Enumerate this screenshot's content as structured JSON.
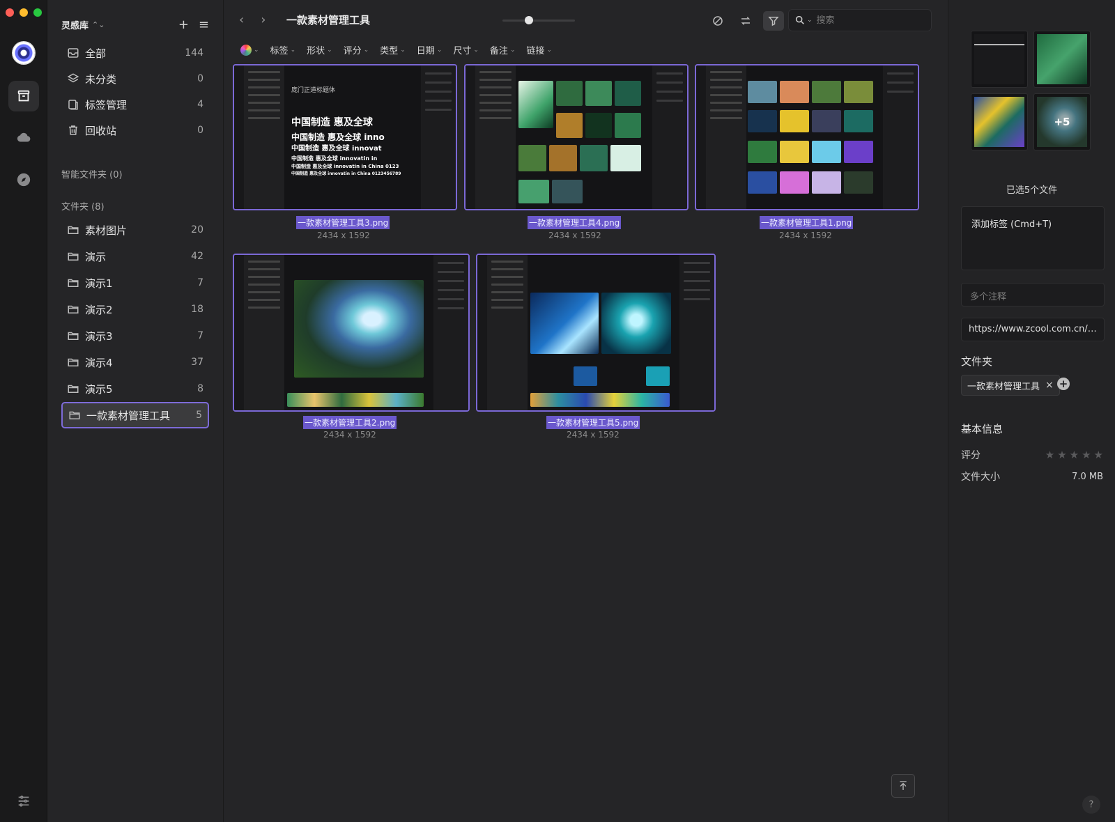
{
  "sidebar": {
    "library_title": "灵感库",
    "nav": [
      {
        "label": "全部",
        "count": "144"
      },
      {
        "label": "未分类",
        "count": "0"
      },
      {
        "label": "标签管理",
        "count": "4"
      },
      {
        "label": "回收站",
        "count": "0"
      }
    ],
    "smart_folders_label": "智能文件夹 (0)",
    "folders_label": "文件夹 (8)",
    "folders": [
      {
        "label": "素材图片",
        "count": "20"
      },
      {
        "label": "演示",
        "count": "42"
      },
      {
        "label": "演示1",
        "count": "7"
      },
      {
        "label": "演示2",
        "count": "18"
      },
      {
        "label": "演示3",
        "count": "7"
      },
      {
        "label": "演示4",
        "count": "37"
      },
      {
        "label": "演示5",
        "count": "8"
      },
      {
        "label": "一款素材管理工具",
        "count": "5"
      }
    ]
  },
  "main": {
    "title": "一款素材管理工具",
    "zoom_level": 0.35,
    "search_placeholder": "搜索",
    "filters": [
      "标签",
      "形状",
      "评分",
      "类型",
      "日期",
      "尺寸",
      "备注",
      "链接"
    ],
    "items": [
      {
        "name": "一款素材管理工具3.png",
        "dims": "2434 x 1592",
        "theme": "text",
        "text_lines": [
          "庞门正道标题体",
          "中国制造 惠及全球",
          "中国制造 惠及全球 inno",
          "中国制造 惠及全球 innovat",
          "中国制造 惠及全球 innovatin in",
          "中国制造 惠及全球 innovatin in China 0123",
          "中国制造 惠及全球 innovatin in China 0123456789"
        ]
      },
      {
        "name": "一款素材管理工具4.png",
        "dims": "2434 x 1592",
        "theme": "green"
      },
      {
        "name": "一款素材管理工具1.png",
        "dims": "2434 x 1592",
        "theme": "grid"
      },
      {
        "name": "一款素材管理工具2.png",
        "dims": "2434 x 1592",
        "theme": "art"
      },
      {
        "name": "一款素材管理工具5.png",
        "dims": "2434 x 1592",
        "theme": "blue"
      }
    ]
  },
  "inspector": {
    "extra_count": "+5",
    "selected_label": "已选5个文件",
    "add_tag_label": "添加标签 (Cmd+T)",
    "note_placeholder": "多个注释",
    "url": "https://www.zcool.com.cn/art...",
    "folder_heading": "文件夹",
    "folder_chip": "一款素材管理工具",
    "basic_info_heading": "基本信息",
    "rating_label": "评分",
    "rating_value": 0,
    "size_label": "文件大小",
    "size_value": "7.0 MB"
  },
  "colors": {
    "accent": "#7b68d6",
    "selection_fill": "#6a58cc",
    "background": "#252527"
  }
}
